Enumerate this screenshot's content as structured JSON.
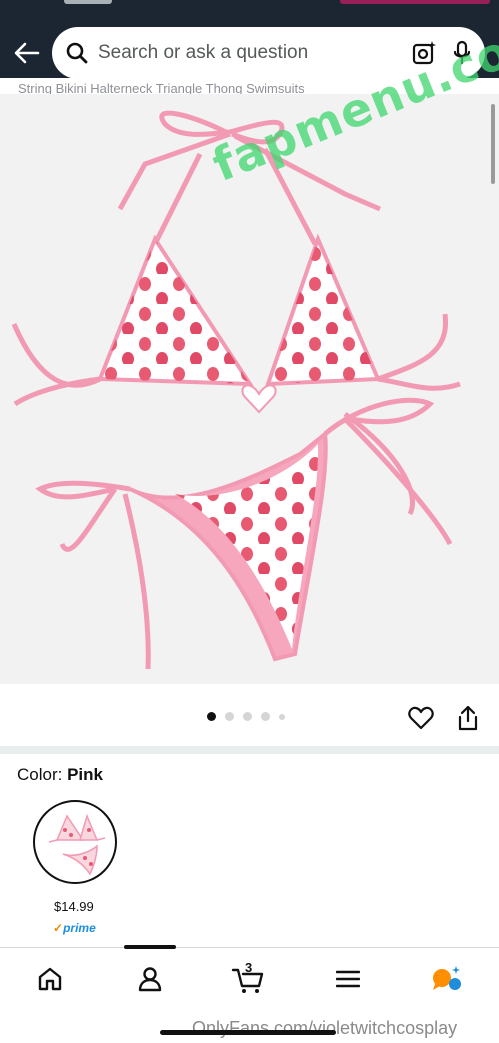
{
  "header": {
    "search_placeholder": "Search or ask a question",
    "product_title_fragment": "String Bikini Halterneck Triangle Thong Swimsuits"
  },
  "image": {
    "watermark": "fapmenu.com",
    "dots": {
      "total": 5,
      "active": 1
    }
  },
  "product": {
    "color_label": "Color:",
    "color_value": "Pink",
    "price": "$14.99",
    "prime_label": "prime"
  },
  "nav": {
    "cart_count": "3"
  },
  "footer_watermark": "OnlyFans.com/violetwitchcosplay",
  "colors": {
    "header_bg": "#1c2633",
    "prime_blue": "#1b8ee0",
    "accent_orange": "#ff8f00",
    "accent_blue": "#1f8ddb"
  }
}
